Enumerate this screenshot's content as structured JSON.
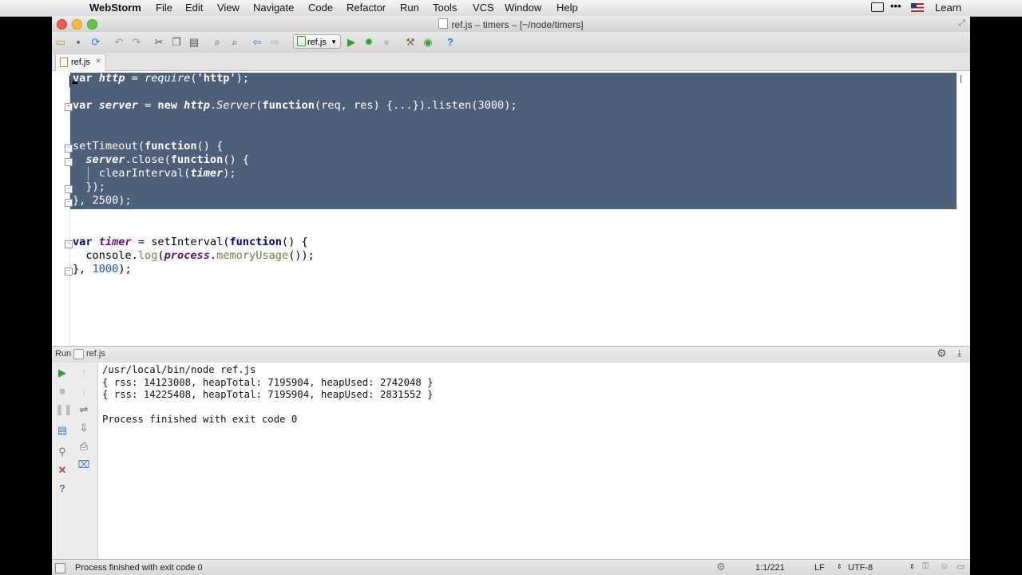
{
  "menubar": {
    "app_name": "WebStorm",
    "items": [
      "File",
      "Edit",
      "View",
      "Navigate",
      "Code",
      "Refactor",
      "Run",
      "Tools",
      "VCS",
      "Window",
      "Help"
    ],
    "right_label": "Learn"
  },
  "window": {
    "title": "ref.js – timers – [~/node/timers]"
  },
  "toolbar": {
    "run_config": "ref.js",
    "help_label": "?"
  },
  "editor": {
    "tab_label": "ref.js",
    "tab_close": "×",
    "lines": {
      "l1_kw": "var",
      "l1_name": "http",
      "l1_eq": " = ",
      "l1_fn": "require",
      "l1_p1": "(",
      "l1_str": "'http'",
      "l1_p2": ");",
      "l2_kw": "var",
      "l2_name": "server",
      "l2_eq": " = ",
      "l2_new": "new",
      "l2_obj": "http",
      "l2_dot": ".",
      "l2_cls": "Server",
      "l2_p": "(",
      "l2_func": "function",
      "l2_args": "(req, res) {...}).listen(3000);",
      "l3_fn": "setTimeout(",
      "l3_func": "function",
      "l3_rest": "() {",
      "l4_obj": "server",
      "l4_mid": ".close(",
      "l4_func": "function",
      "l4_rest": "() {",
      "l5_fn": "clearInterval(",
      "l5_var": "timer",
      "l5_rest": ");",
      "l6": "});",
      "l7": "}, 2500);",
      "l8_kw": "var",
      "l8_name": "timer",
      "l8_eq": " = setInterval(",
      "l8_func": "function",
      "l8_rest": "() {",
      "l9_obj": "console.",
      "l9_fn": "log",
      "l9_p": "(",
      "l9_var": "process",
      "l9_dot": ".",
      "l9_m": "memoryUsage",
      "l9_rest": "());",
      "l10_a": "}, ",
      "l10_num": "1000",
      "l10_b": ");"
    }
  },
  "run_panel": {
    "label": "Run",
    "config": "ref.js",
    "console": [
      "/usr/local/bin/node ref.js",
      "{ rss: 14123008, heapTotal: 7195904, heapUsed: 2742048 }",
      "{ rss: 14225408, heapTotal: 7195904, heapUsed: 2831552 }",
      "",
      "Process finished with exit code 0"
    ]
  },
  "statusbar": {
    "message": "Process finished with exit code 0",
    "position": "1:1/221",
    "line_sep": "LF",
    "encoding": "UTF-8"
  },
  "colors": {
    "selection": "#4d5f79",
    "run_green": "#2aa52a",
    "stop_red": "#d23b3b"
  },
  "icons": [
    "apple-icon",
    "open-folder-icon",
    "save-icon",
    "sync-icon",
    "undo-icon",
    "redo-icon",
    "cut-icon",
    "copy-icon",
    "paste-icon",
    "find-icon",
    "replace-icon",
    "back-icon",
    "forward-icon",
    "run-icon",
    "debug-icon",
    "stop-icon",
    "settings-icon",
    "structure-icon",
    "help-icon",
    "gear-icon",
    "pin-icon",
    "close-icon",
    "rerun-icon",
    "trash-icon"
  ]
}
